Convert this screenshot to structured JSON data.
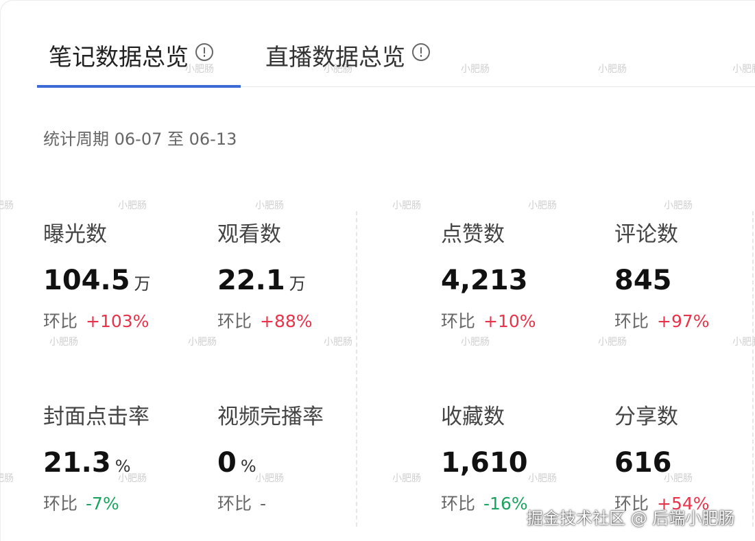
{
  "tabs": [
    {
      "label": "笔记数据总览",
      "active": true
    },
    {
      "label": "直播数据总览",
      "active": false
    }
  ],
  "period": "统计周期 06-07 至 06-13",
  "compare_label": "环比",
  "metrics": [
    {
      "label": "曝光数",
      "value": "104.5",
      "unit": "万",
      "change": "+103%",
      "trend": "up"
    },
    {
      "label": "观看数",
      "value": "22.1",
      "unit": "万",
      "change": "+88%",
      "trend": "up"
    },
    {
      "label": "点赞数",
      "value": "4,213",
      "unit": "",
      "change": "+10%",
      "trend": "up"
    },
    {
      "label": "评论数",
      "value": "845",
      "unit": "",
      "change": "+97%",
      "trend": "up"
    },
    {
      "label": "封面点击率",
      "value": "21.3",
      "unit": "%",
      "change": "-7%",
      "trend": "down"
    },
    {
      "label": "视频完播率",
      "value": "0",
      "unit": "%",
      "change": "-",
      "trend": "flat"
    },
    {
      "label": "收藏数",
      "value": "1,610",
      "unit": "",
      "change": "-16%",
      "trend": "down"
    },
    {
      "label": "分享数",
      "value": "616",
      "unit": "",
      "change": "+54%",
      "trend": "up"
    }
  ],
  "watermark": "小肥肠",
  "footer_watermark": "掘金技术社区 @ 后端小肥肠",
  "colors": {
    "accent": "#3e6ad6",
    "up": "#e8334a",
    "down": "#1aa35f"
  }
}
